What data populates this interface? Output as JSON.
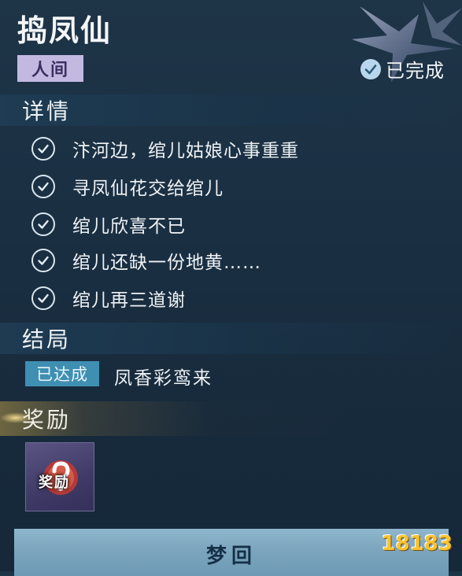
{
  "quest": {
    "title": "捣凤仙",
    "realm_tag": "人间",
    "status_label": "已完成"
  },
  "details": {
    "heading": "详情",
    "steps": [
      {
        "text": "汴河边，绾儿姑娘心事重重",
        "done": true
      },
      {
        "text": "寻凤仙花交给绾儿",
        "done": true
      },
      {
        "text": "绾儿欣喜不已",
        "done": true
      },
      {
        "text": "绾儿还缺一份地黄……",
        "done": true
      },
      {
        "text": "绾儿再三道谢",
        "done": true
      }
    ]
  },
  "ending": {
    "heading": "结局",
    "achieved_label": "已达成",
    "name": "凤香彩鸾来"
  },
  "reward": {
    "heading": "奖励",
    "item_label": "奖励"
  },
  "actions": {
    "dream_label": "梦回"
  },
  "watermark": {
    "text": "18183"
  },
  "colors": {
    "accent_blue": "#3f8fb3",
    "realm_tag_bg": "#c3b9e0",
    "button_bg": "#7aa4bd"
  }
}
